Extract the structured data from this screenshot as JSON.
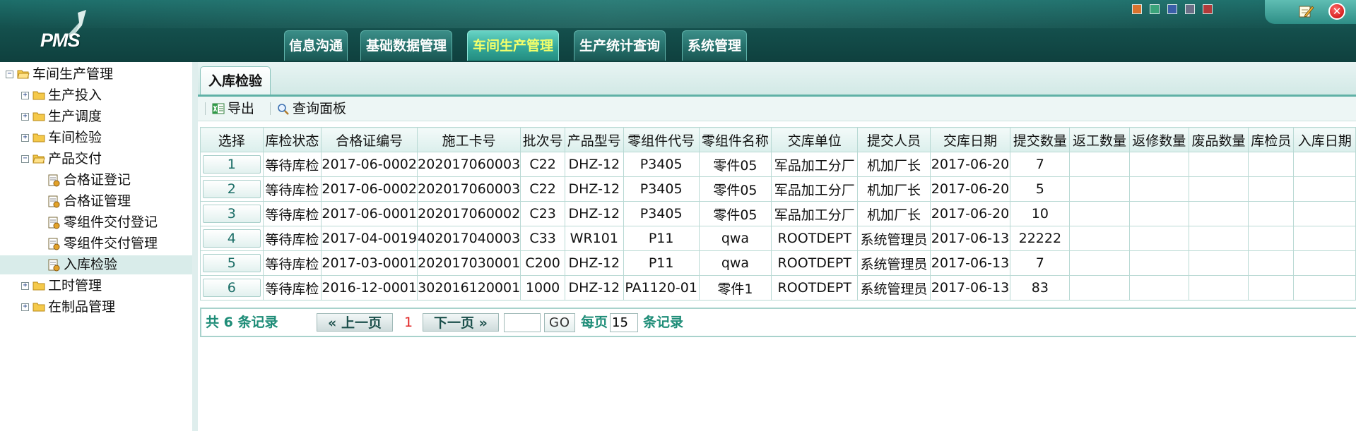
{
  "header": {
    "logo_text": "PMS",
    "nav_tabs": [
      {
        "label": "信息沟通",
        "active": false
      },
      {
        "label": "基础数据管理",
        "active": false
      },
      {
        "label": "车间生产管理",
        "active": true
      },
      {
        "label": "生产统计查询",
        "active": false
      },
      {
        "label": "系统管理",
        "active": false
      }
    ],
    "theme_swatches": [
      "#d9732e",
      "#3aa37a",
      "#3a5fa8",
      "#6a6f86",
      "#b23a3a"
    ],
    "accent_color": "#f3ff6a"
  },
  "sidebar": {
    "items": [
      {
        "label": "车间生产管理",
        "toggle": "−",
        "icon": "folder-open-icon"
      },
      {
        "label": "生产投入",
        "toggle": "+",
        "icon": "folder-icon"
      },
      {
        "label": "生产调度",
        "toggle": "+",
        "icon": "folder-icon"
      },
      {
        "label": "车间检验",
        "toggle": "+",
        "icon": "folder-icon"
      },
      {
        "label": "产品交付",
        "toggle": "−",
        "icon": "folder-open-icon"
      },
      {
        "label": "合格证登记",
        "icon": "document-icon"
      },
      {
        "label": "合格证管理",
        "icon": "document-icon"
      },
      {
        "label": "零组件交付登记",
        "icon": "document-icon"
      },
      {
        "label": "零组件交付管理",
        "icon": "document-icon"
      },
      {
        "label": "入库检验",
        "icon": "document-icon",
        "selected": true
      },
      {
        "label": "工时管理",
        "toggle": "+",
        "icon": "folder-icon"
      },
      {
        "label": "在制品管理",
        "toggle": "+",
        "icon": "folder-icon"
      }
    ]
  },
  "main": {
    "tab_label": "入库检验",
    "toolbar": {
      "export_label": "导出",
      "query_label": "查询面板"
    },
    "table": {
      "columns": [
        "选择",
        "库检状态",
        "合格证编号",
        "施工卡号",
        "批次号",
        "产品型号",
        "零组件代号",
        "零组件名称",
        "交库单位",
        "提交人员",
        "交库日期",
        "提交数量",
        "返工数量",
        "返修数量",
        "废品数量",
        "库检员",
        "入库日期"
      ],
      "rows": [
        [
          "1",
          "等待库检",
          "2017-06-0002",
          "202017060003",
          "C22",
          "DHZ-12",
          "P3405",
          "零件05",
          "军品加工分厂",
          "机加厂长",
          "2017-06-20",
          "7",
          "",
          "",
          "",
          "",
          ""
        ],
        [
          "2",
          "等待库检",
          "2017-06-0002",
          "202017060003",
          "C22",
          "DHZ-12",
          "P3405",
          "零件05",
          "军品加工分厂",
          "机加厂长",
          "2017-06-20",
          "5",
          "",
          "",
          "",
          "",
          ""
        ],
        [
          "3",
          "等待库检",
          "2017-06-0001",
          "202017060002",
          "C23",
          "DHZ-12",
          "P3405",
          "零件05",
          "军品加工分厂",
          "机加厂长",
          "2017-06-20",
          "10",
          "",
          "",
          "",
          "",
          ""
        ],
        [
          "4",
          "等待库检",
          "2017-04-0019",
          "402017040003",
          "C33",
          "WR101",
          "P11",
          "qwa",
          "ROOTDEPT",
          "系统管理员",
          "2017-06-13",
          "22222",
          "",
          "",
          "",
          "",
          ""
        ],
        [
          "5",
          "等待库检",
          "2017-03-0001",
          "202017030001",
          "C200",
          "DHZ-12",
          "P11",
          "qwa",
          "ROOTDEPT",
          "系统管理员",
          "2017-06-13",
          "7",
          "",
          "",
          "",
          "",
          ""
        ],
        [
          "6",
          "等待库检",
          "2016-12-0001",
          "302016120001",
          "1000",
          "DHZ-12",
          "PA1120-01",
          "零件1",
          "ROOTDEPT",
          "系统管理员",
          "2017-06-13",
          "83",
          "",
          "",
          "",
          "",
          ""
        ]
      ]
    },
    "pager": {
      "total_text": "共 6 条记录",
      "prev_label": "上一页",
      "current_page": "1",
      "next_label": "下一页",
      "page_input_value": "",
      "go_label": "GO",
      "per_page_prefix": "每页",
      "per_page_value": "15",
      "per_page_suffix": "条记录"
    }
  }
}
